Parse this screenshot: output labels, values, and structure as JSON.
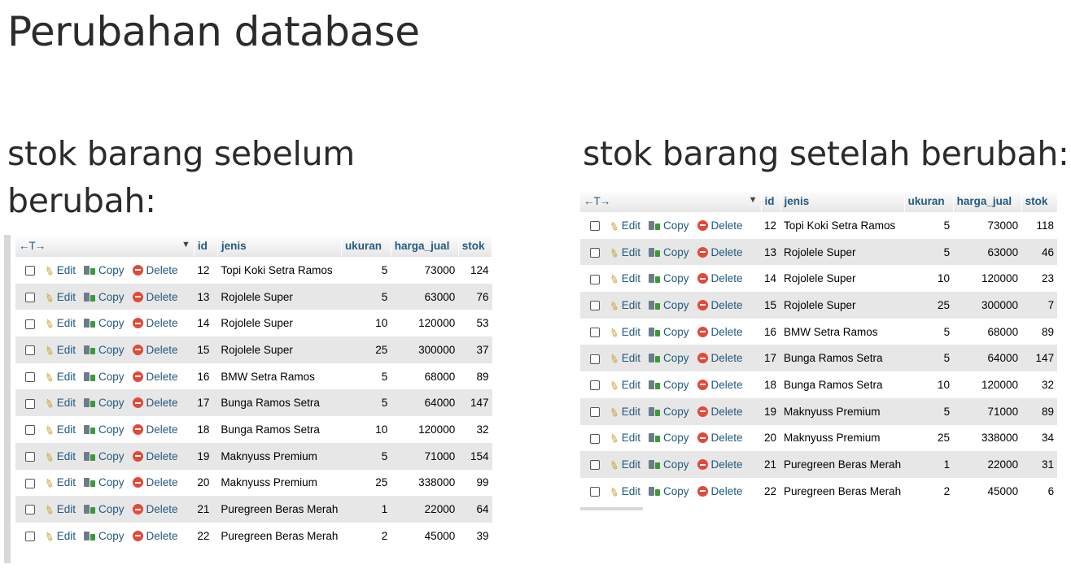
{
  "title": "Perubahan database",
  "left": {
    "heading": "stok barang sebelum berubah:",
    "columns": [
      "id",
      "jenis",
      "ukuran",
      "harga_jual",
      "stok"
    ],
    "actions": {
      "edit": "Edit",
      "copy": "Copy",
      "delete": "Delete"
    },
    "nav_arrows": "←T→",
    "rows": [
      {
        "id": "12",
        "jenis": "Topi Koki Setra Ramos",
        "ukuran": "5",
        "harga_jual": "73000",
        "stok": "124"
      },
      {
        "id": "13",
        "jenis": "Rojolele Super",
        "ukuran": "5",
        "harga_jual": "63000",
        "stok": "76"
      },
      {
        "id": "14",
        "jenis": "Rojolele Super",
        "ukuran": "10",
        "harga_jual": "120000",
        "stok": "53"
      },
      {
        "id": "15",
        "jenis": "Rojolele Super",
        "ukuran": "25",
        "harga_jual": "300000",
        "stok": "37"
      },
      {
        "id": "16",
        "jenis": "BMW Setra Ramos",
        "ukuran": "5",
        "harga_jual": "68000",
        "stok": "89"
      },
      {
        "id": "17",
        "jenis": "Bunga Ramos Setra",
        "ukuran": "5",
        "harga_jual": "64000",
        "stok": "147"
      },
      {
        "id": "18",
        "jenis": "Bunga Ramos Setra",
        "ukuran": "10",
        "harga_jual": "120000",
        "stok": "32"
      },
      {
        "id": "19",
        "jenis": "Maknyuss Premium",
        "ukuran": "5",
        "harga_jual": "71000",
        "stok": "154"
      },
      {
        "id": "20",
        "jenis": "Maknyuss Premium",
        "ukuran": "25",
        "harga_jual": "338000",
        "stok": "99"
      },
      {
        "id": "21",
        "jenis": "Puregreen Beras Merah",
        "ukuran": "1",
        "harga_jual": "22000",
        "stok": "64"
      },
      {
        "id": "22",
        "jenis": "Puregreen Beras Merah",
        "ukuran": "2",
        "harga_jual": "45000",
        "stok": "39"
      }
    ]
  },
  "right": {
    "heading": "stok barang setelah berubah:",
    "columns": [
      "id",
      "jenis",
      "ukuran",
      "harga_jual",
      "stok"
    ],
    "actions": {
      "edit": "Edit",
      "copy": "Copy",
      "delete": "Delete"
    },
    "nav_arrows": "←T→",
    "rows": [
      {
        "id": "12",
        "jenis": "Topi Koki Setra Ramos",
        "ukuran": "5",
        "harga_jual": "73000",
        "stok": "118"
      },
      {
        "id": "13",
        "jenis": "Rojolele Super",
        "ukuran": "5",
        "harga_jual": "63000",
        "stok": "46"
      },
      {
        "id": "14",
        "jenis": "Rojolele Super",
        "ukuran": "10",
        "harga_jual": "120000",
        "stok": "23"
      },
      {
        "id": "15",
        "jenis": "Rojolele Super",
        "ukuran": "25",
        "harga_jual": "300000",
        "stok": "7"
      },
      {
        "id": "16",
        "jenis": "BMW Setra Ramos",
        "ukuran": "5",
        "harga_jual": "68000",
        "stok": "89"
      },
      {
        "id": "17",
        "jenis": "Bunga Ramos Setra",
        "ukuran": "5",
        "harga_jual": "64000",
        "stok": "147"
      },
      {
        "id": "18",
        "jenis": "Bunga Ramos Setra",
        "ukuran": "10",
        "harga_jual": "120000",
        "stok": "32"
      },
      {
        "id": "19",
        "jenis": "Maknyuss Premium",
        "ukuran": "5",
        "harga_jual": "71000",
        "stok": "89"
      },
      {
        "id": "20",
        "jenis": "Maknyuss Premium",
        "ukuran": "25",
        "harga_jual": "338000",
        "stok": "34"
      },
      {
        "id": "21",
        "jenis": "Puregreen Beras Merah",
        "ukuran": "1",
        "harga_jual": "22000",
        "stok": "31"
      },
      {
        "id": "22",
        "jenis": "Puregreen Beras Merah",
        "ukuran": "2",
        "harga_jual": "45000",
        "stok": "6"
      }
    ]
  }
}
